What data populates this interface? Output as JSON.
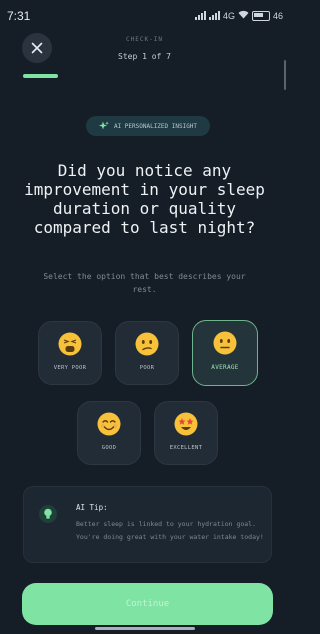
{
  "status": {
    "time": "7:31",
    "network": "4G",
    "battery_label": "46"
  },
  "header": {
    "eyebrow": "CHECK-IN",
    "step": "Step 1 of 7"
  },
  "progress": {
    "fraction": 0.142857
  },
  "badge": {
    "label": "AI PERSONALIZED INSIGHT"
  },
  "question": "Did you notice any improvement in your sleep duration or quality compared to last night?",
  "hint": "Select the option that best describes your rest.",
  "options": [
    {
      "label": "VERY POOR",
      "mood": "very-poor",
      "selected": false
    },
    {
      "label": "POOR",
      "mood": "poor",
      "selected": false
    },
    {
      "label": "AVERAGE",
      "mood": "average",
      "selected": true
    },
    {
      "label": "GOOD",
      "mood": "good",
      "selected": false
    },
    {
      "label": "EXCELLENT",
      "mood": "excellent",
      "selected": false
    }
  ],
  "tip": {
    "title": "AI Tip:",
    "body": "Better sleep is linked to your hydration goal. You're doing great with your water intake today!"
  },
  "continue_label": "Continue",
  "colors": {
    "accent": "#7fe3a3",
    "background": "#151d26",
    "selected_border": "#6fb48a"
  }
}
